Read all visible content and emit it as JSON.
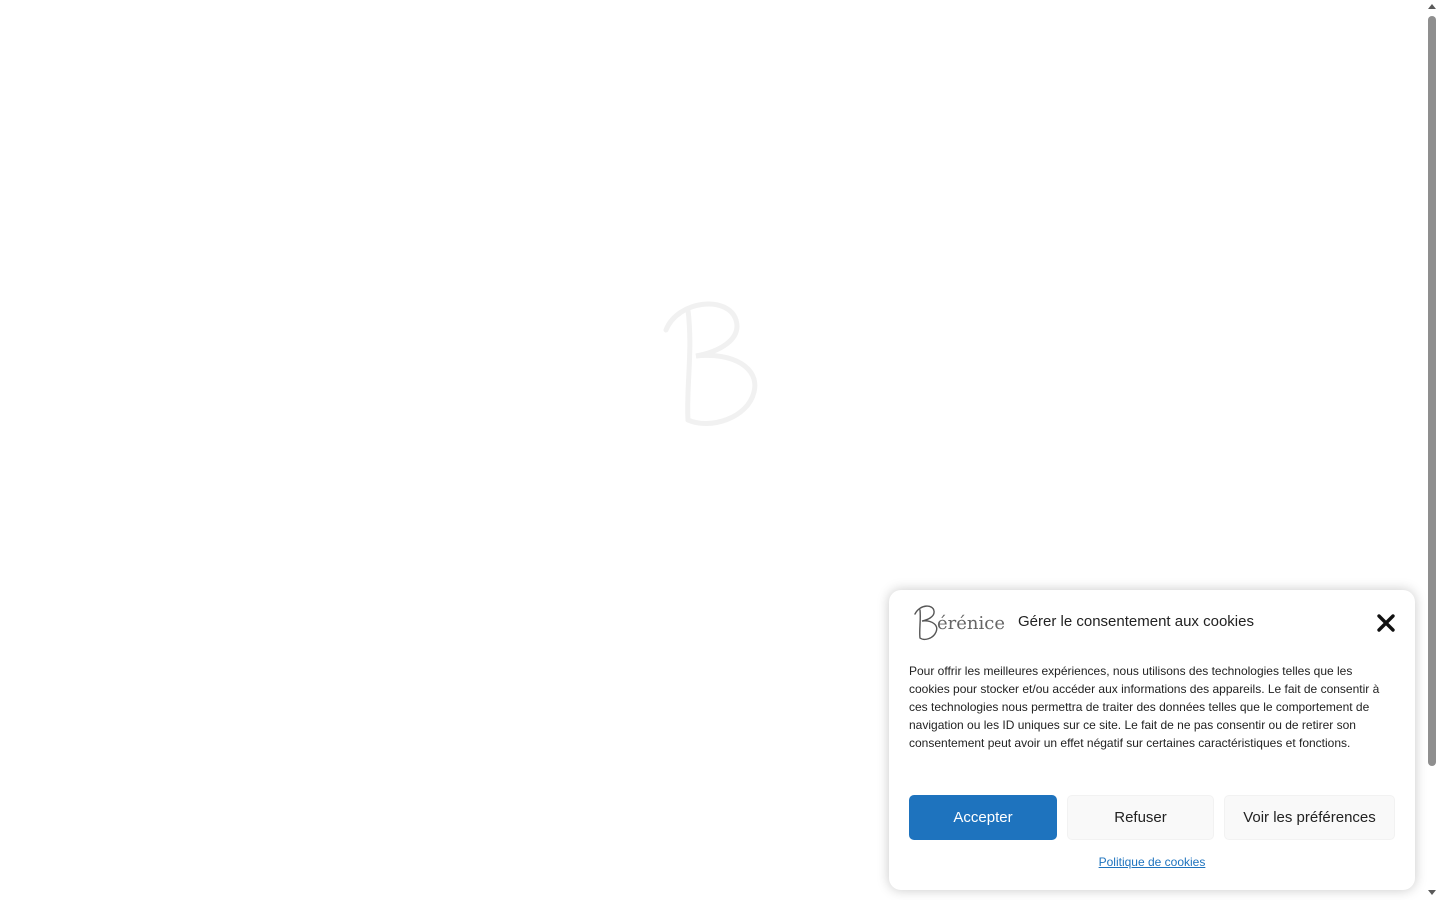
{
  "page": {
    "background": "#ffffff",
    "loader_icon": "monogram-b-icon"
  },
  "cookie_banner": {
    "logo_text": "Bérénice",
    "title": "Gérer le consentement aux cookies",
    "close_icon": "close-icon",
    "description": "Pour offrir les meilleures expériences, nous utilisons des technologies telles que les cookies pour stocker et/ou accéder aux informations des appareils. Le fait de consentir à ces technologies nous permettra de traiter des données telles que le comportement de navigation ou les ID uniques sur ce site. Le fait de ne pas consentir ou de retirer son consentement peut avoir un effet négatif sur certaines caractéristiques et fonctions.",
    "buttons": {
      "accept": "Accepter",
      "deny": "Refuser",
      "preferences": "Voir les préférences"
    },
    "policy_link": "Politique de cookies",
    "colors": {
      "accent": "#1e73be",
      "secondary_button": "#f9f9f9",
      "text": "#222222"
    }
  }
}
